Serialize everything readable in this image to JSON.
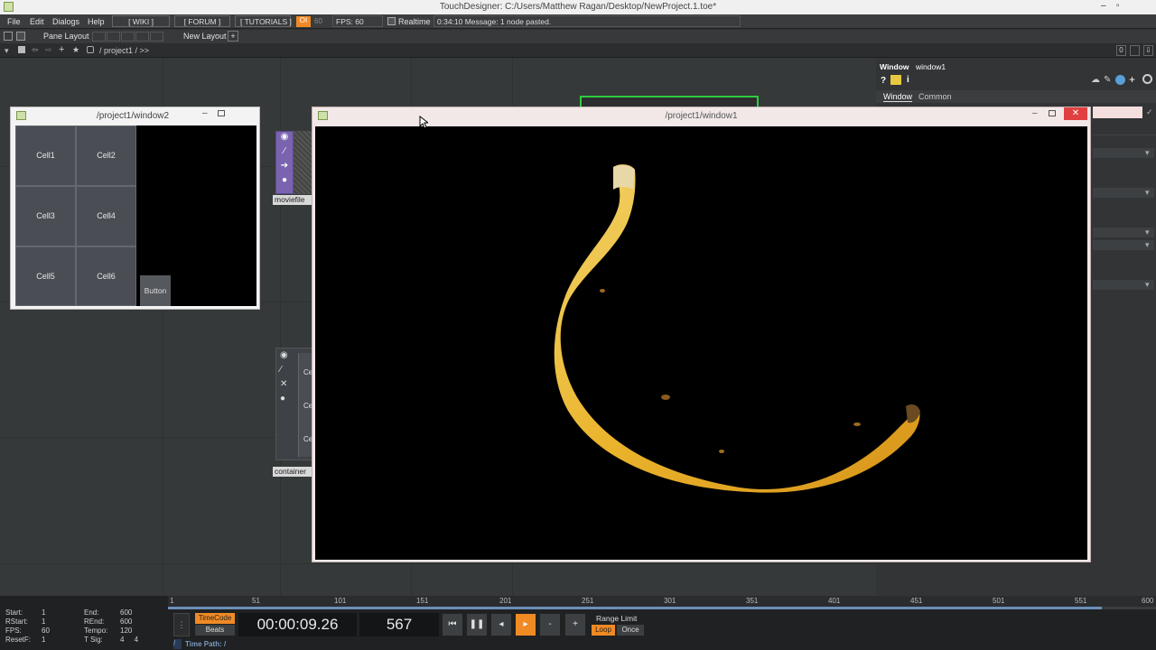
{
  "title_bar": {
    "title": "TouchDesigner: C:/Users/Matthew Ragan/Desktop/NewProject.1.toe*",
    "minimize": "–",
    "maximize": "▫"
  },
  "menu": {
    "items": [
      "File",
      "Edit",
      "Dialogs",
      "Help"
    ],
    "links": [
      "[ WIKI ]",
      "[ FORUM ]",
      "[ TUTORIALS ]"
    ],
    "oi_label": "OI",
    "fps_cap": "60",
    "fps_label": "FPS:  60",
    "realtime_label": "Realtime",
    "message": "0:34:10 Message: 1 node pasted."
  },
  "layout_bar": {
    "pane_layout_label": "Pane Layout",
    "new_layout_label": "New Layout",
    "plus": "+"
  },
  "path_bar": {
    "path": "/ project1 / >>",
    "zero_label": "0"
  },
  "window2": {
    "title": "/project1/window2",
    "cells": [
      "Cell1",
      "Cell2",
      "Cell3",
      "Cell4",
      "Cell5",
      "Cell6"
    ],
    "button_label": "Button"
  },
  "nodes": {
    "moviefile_label": "moviefile",
    "container_label": "container",
    "container_peek": [
      "Ce",
      "Ce",
      "Ce"
    ]
  },
  "window1": {
    "title": "/project1/window1",
    "close": "✕"
  },
  "params": {
    "op_type": "Window",
    "op_name": "window1",
    "tabs": [
      "Window",
      "Common"
    ]
  },
  "timeline": {
    "stats_left": [
      {
        "k": "Start:",
        "v": "1"
      },
      {
        "k": "RStart:",
        "v": "1"
      },
      {
        "k": "FPS:",
        "v": "60"
      },
      {
        "k": "ResetF:",
        "v": "1"
      }
    ],
    "stats_right": [
      {
        "k": "End:",
        "v": "600"
      },
      {
        "k": "REnd:",
        "v": "600"
      },
      {
        "k": "Tempo:",
        "v": "120"
      },
      {
        "k": "T Sig:",
        "v": "4     4"
      }
    ],
    "ticks": [
      "1",
      "51",
      "101",
      "151",
      "201",
      "251",
      "301",
      "351",
      "401",
      "451",
      "501",
      "551",
      "600"
    ],
    "timecode_label": "TimeCode",
    "beats_label": "Beats",
    "timecode": "00:00:09.26",
    "frame": "567",
    "range_limit_label": "Range Limit",
    "loop_label": "Loop",
    "once_label": "Once",
    "time_path": "Time Path: /",
    "playhead_progress": 0.945
  },
  "colors": {
    "accent_orange": "#f08a24",
    "node_purple": "#7a64b0",
    "select_green": "#2ecc40"
  }
}
